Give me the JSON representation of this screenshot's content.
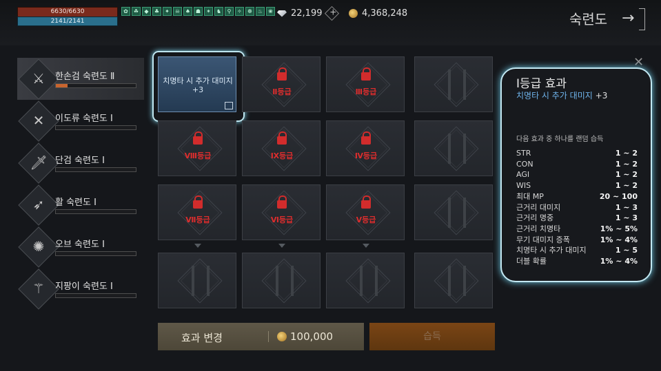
{
  "player": {
    "hp": "6630/6630",
    "mp": "2141/2141"
  },
  "buff_icons": [
    "✿",
    "☘",
    "◆",
    "♣",
    "✦",
    "☠",
    "♠",
    "☗",
    "✶",
    "♞",
    "⚲",
    "✧",
    "☸",
    "♨",
    "❀"
  ],
  "currency": {
    "diamonds": "22,199",
    "gold": "4,368,248"
  },
  "header": {
    "title": "숙련도",
    "exit_icon": "→"
  },
  "skills": [
    {
      "name": "한손검 숙련도 Ⅱ",
      "icon": "⚔",
      "progress": 0.15
    },
    {
      "name": "이도류 숙련도 Ⅰ",
      "icon": "✕",
      "progress": 0
    },
    {
      "name": "단검 숙련도 Ⅰ",
      "icon": "🗡",
      "progress": 0
    },
    {
      "name": "활 숙련도 Ⅰ",
      "icon": "➶",
      "progress": 0
    },
    {
      "name": "오브 숙련도 Ⅰ",
      "icon": "✺",
      "progress": 0
    },
    {
      "name": "지팡이 숙련도 Ⅰ",
      "icon": "⚚",
      "progress": 0
    }
  ],
  "grid": {
    "selected_text": "치명타 시 추가 대미지 +3",
    "labels": {
      "r1c2": "Ⅱ등급",
      "r1c3": "Ⅲ등급",
      "r2c1": "Ⅷ등급",
      "r2c2": "Ⅸ등급",
      "r2c3": "Ⅳ등급",
      "r3c1": "Ⅶ등급",
      "r3c2": "Ⅵ등급",
      "r3c3": "Ⅴ등급"
    }
  },
  "buttons": {
    "change": "효과 변경",
    "cost": "100,000",
    "acquire": "습득"
  },
  "effect_panel": {
    "title": "Ⅰ등급 효과",
    "subtitle": "치명타 시 추가 대미지",
    "subtitle_value": "+3",
    "description": "다음 효과 중 하나를 랜덤 습득",
    "stats": [
      {
        "name": "STR",
        "range": "1 ~ 2"
      },
      {
        "name": "CON",
        "range": "1 ~ 2"
      },
      {
        "name": "AGI",
        "range": "1 ~ 2"
      },
      {
        "name": "WIS",
        "range": "1 ~ 2"
      },
      {
        "name": "최대 MP",
        "range": "20 ~ 100"
      },
      {
        "name": "근거리 대미지",
        "range": "1 ~ 3"
      },
      {
        "name": "근거리 명중",
        "range": "1 ~ 3"
      },
      {
        "name": "근거리 치명타",
        "range": "1% ~ 5%"
      },
      {
        "name": "무기 대미지 증폭",
        "range": "1% ~ 4%"
      },
      {
        "name": "치명타 시 추가 대미지",
        "range": "1 ~ 5"
      },
      {
        "name": "더블 확률",
        "range": "1% ~ 4%"
      }
    ],
    "close_icon": "✕"
  }
}
